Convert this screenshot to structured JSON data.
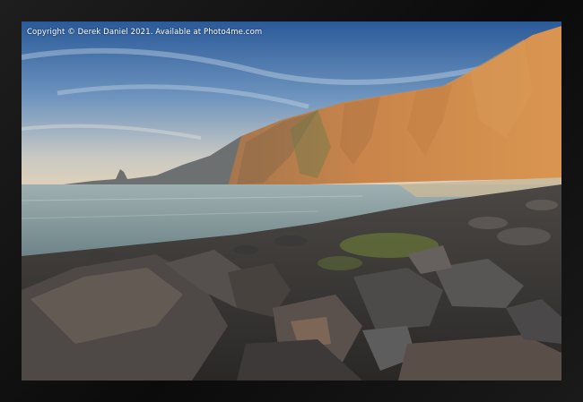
{
  "image": {
    "copyright_text": "Copyright © Derek Daniel 2021. Available at Photo4me.com"
  },
  "colors": {
    "frame": "#111111",
    "sky_top": "#2e5f9f",
    "sky_horizon": "#d9d2c4",
    "cliff_sunlit": "#c9884a",
    "cliff_shadow": "#6d6f6f",
    "sea": "#8fa3a6",
    "rocks": "#3b3a3a"
  }
}
